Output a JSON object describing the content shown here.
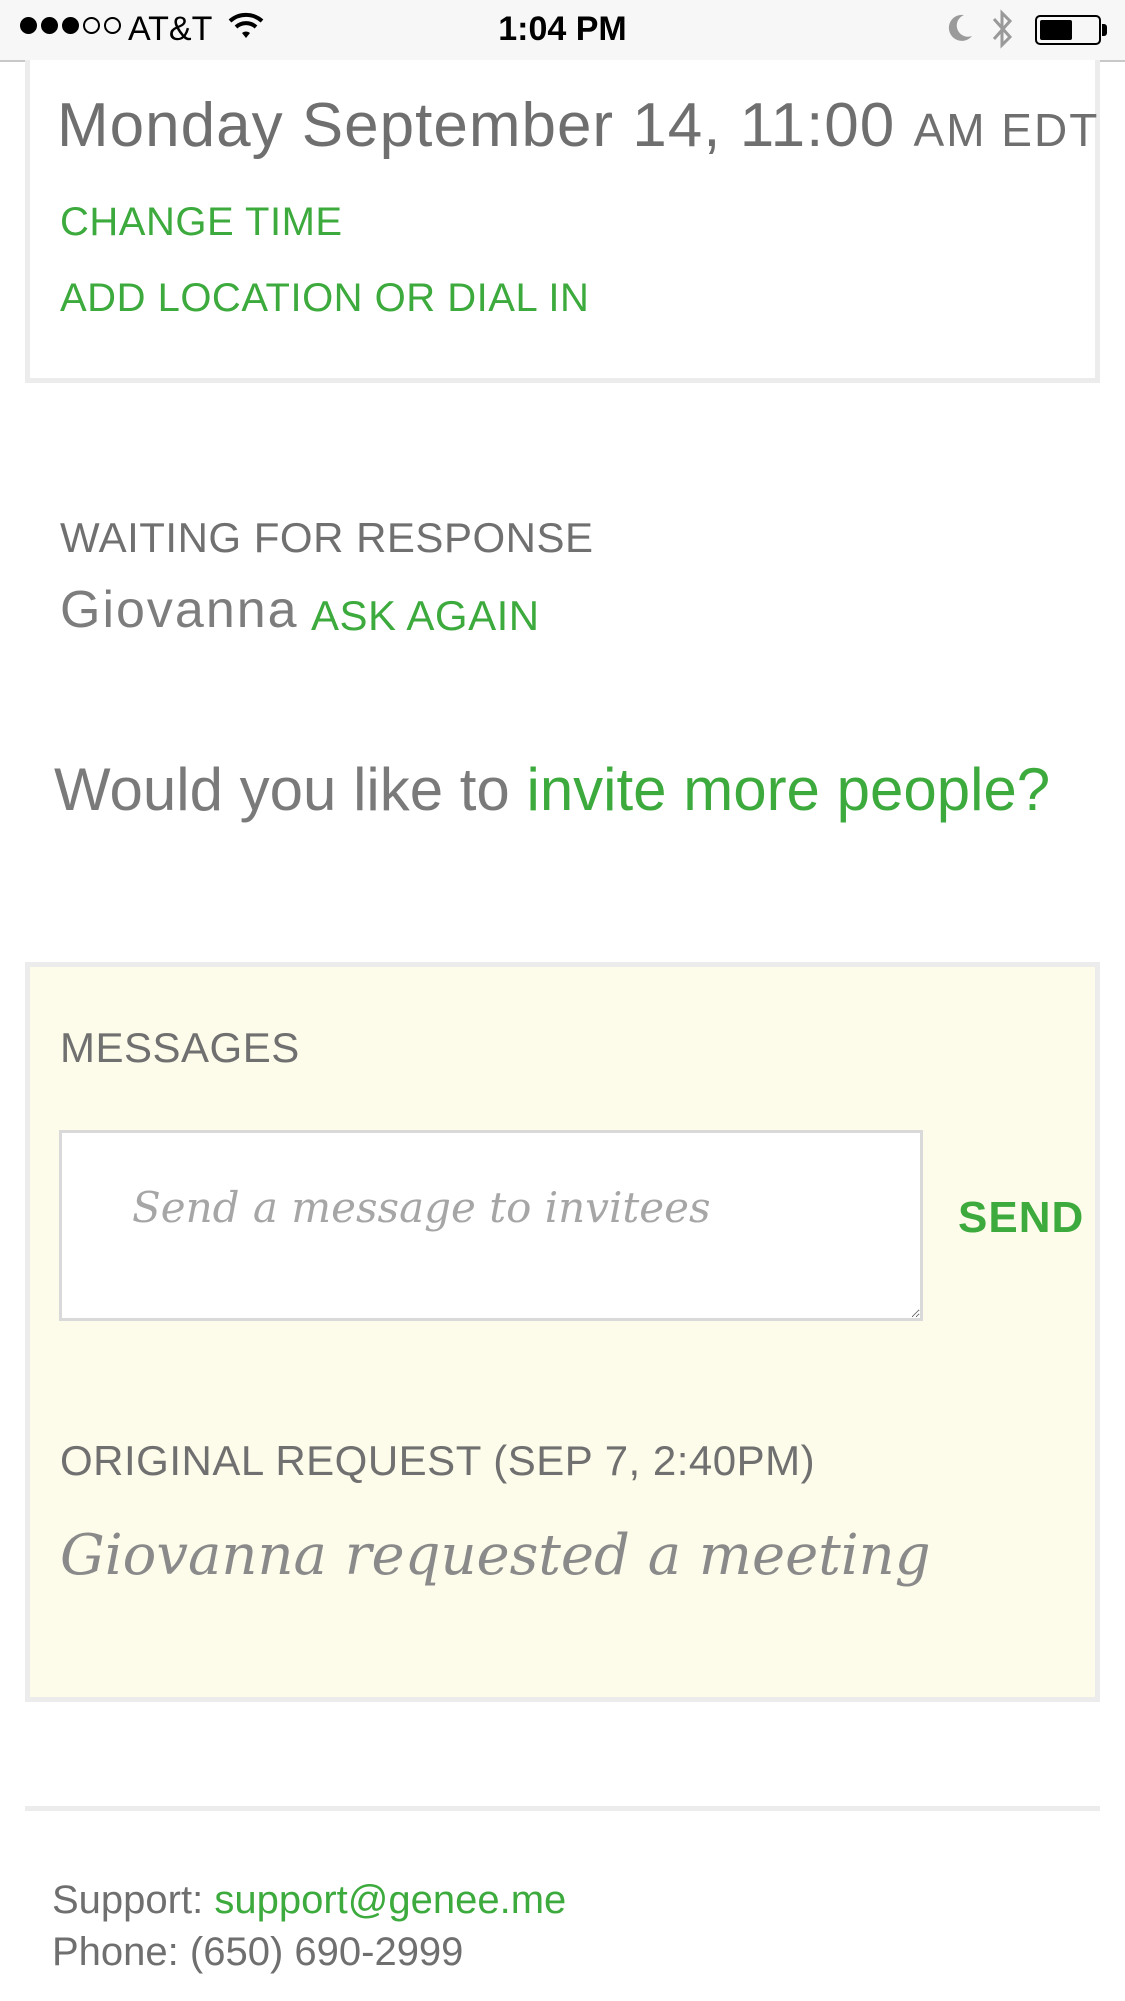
{
  "status_bar": {
    "carrier": "AT&T",
    "time": "1:04 PM",
    "signal_bars_filled": 3,
    "signal_bars_total": 5,
    "battery_level": 0.58,
    "icons": [
      "signal-icon",
      "wifi-icon",
      "moon-icon",
      "bluetooth-icon",
      "battery-icon"
    ]
  },
  "time_card": {
    "date_main": "Monday September 14, 11:00",
    "date_suffix": "AM EDT",
    "change_time_label": "CHANGE TIME",
    "add_location_label": "ADD LOCATION OR DIAL IN"
  },
  "waiting": {
    "heading": "WAITING FOR RESPONSE",
    "invitee_name": "Giovanna",
    "ask_again_label": "ASK AGAIN"
  },
  "invite": {
    "prompt": "Would you like to ",
    "link_text": "invite more people?"
  },
  "messages": {
    "heading": "MESSAGES",
    "input_placeholder": "Send a message to invitees",
    "input_value": "",
    "send_label": "SEND",
    "original_request_label": "ORIGINAL REQUEST (SEP 7, 2:40PM)",
    "original_request_text": "Giovanna requested a meeting"
  },
  "footer": {
    "support_label": "Support: ",
    "support_email": "support@genee.me",
    "phone_line": "Phone: (650) 690-2999"
  },
  "colors": {
    "accent_green": "#3daa3d",
    "text_gray": "#7a7a7a",
    "messages_bg": "#fdfbe9",
    "border_gray": "#ececec"
  }
}
